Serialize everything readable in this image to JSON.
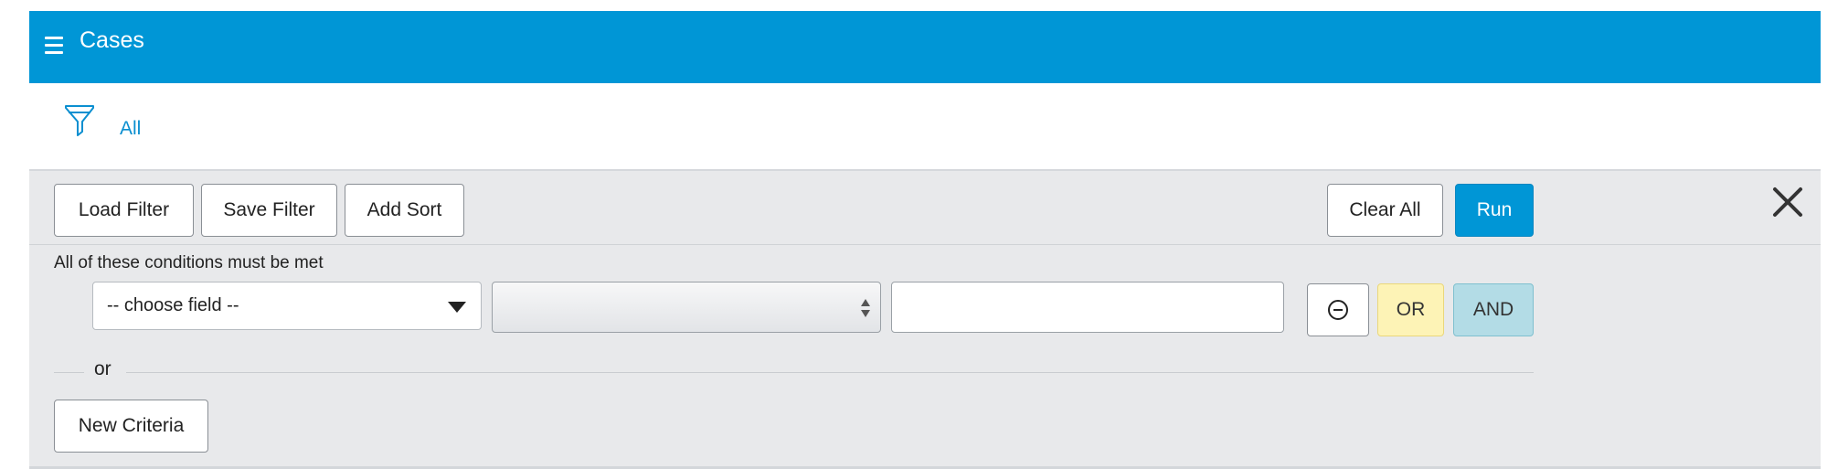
{
  "header": {
    "title": "Cases",
    "background": "#0096d6"
  },
  "filter": {
    "name": "All",
    "icon": "funnel-icon"
  },
  "toolbar": {
    "load_filter": "Load Filter",
    "save_filter": "Save Filter",
    "add_sort": "Add Sort",
    "clear_all": "Clear All",
    "run": "Run",
    "close_icon": "close-icon"
  },
  "criteria": {
    "conditions_label": "All of these conditions must be met",
    "field_select": "-- choose field --",
    "operator_select": "",
    "value_input": "",
    "remove_icon": "minus-circle-icon",
    "or_label": "OR",
    "and_label": "AND",
    "separator": "or",
    "new_criteria": "New Criteria"
  },
  "colors": {
    "accent": "#0096d6",
    "or_button": "#fdf3b6",
    "and_button": "#b3dce6",
    "panel_bg": "#e8e9eb"
  }
}
